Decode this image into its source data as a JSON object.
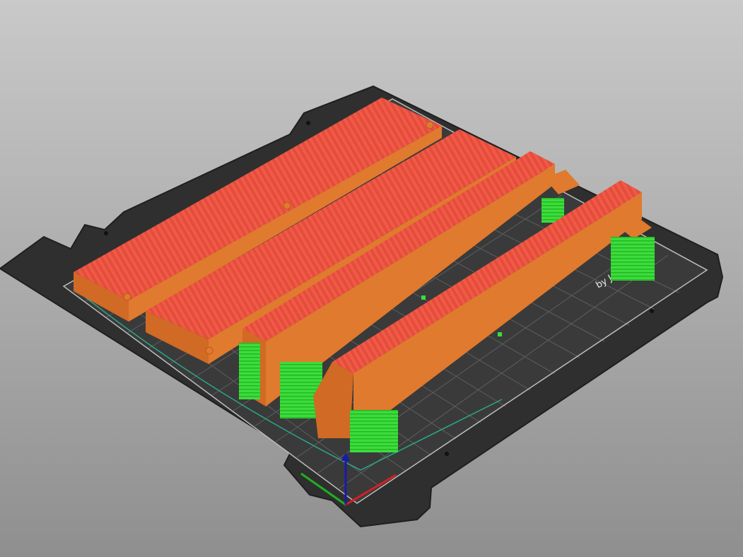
{
  "viewport": {
    "background_top": "#c9c9c9",
    "background_bottom": "#8f8f8f"
  },
  "bed": {
    "surface_color": "#2f2f2f",
    "edge_color": "#1f1f1f",
    "grid_color": "#8a8a8a",
    "logo_text": "by J"
  },
  "parts": {
    "top_face_color": "#e44c3c",
    "side_color": "#e07a2e",
    "support_color": "#3ddc3d"
  },
  "axes": {
    "x_color": "#d42020",
    "y_color": "#20b020",
    "z_color": "#1a1aa8"
  }
}
